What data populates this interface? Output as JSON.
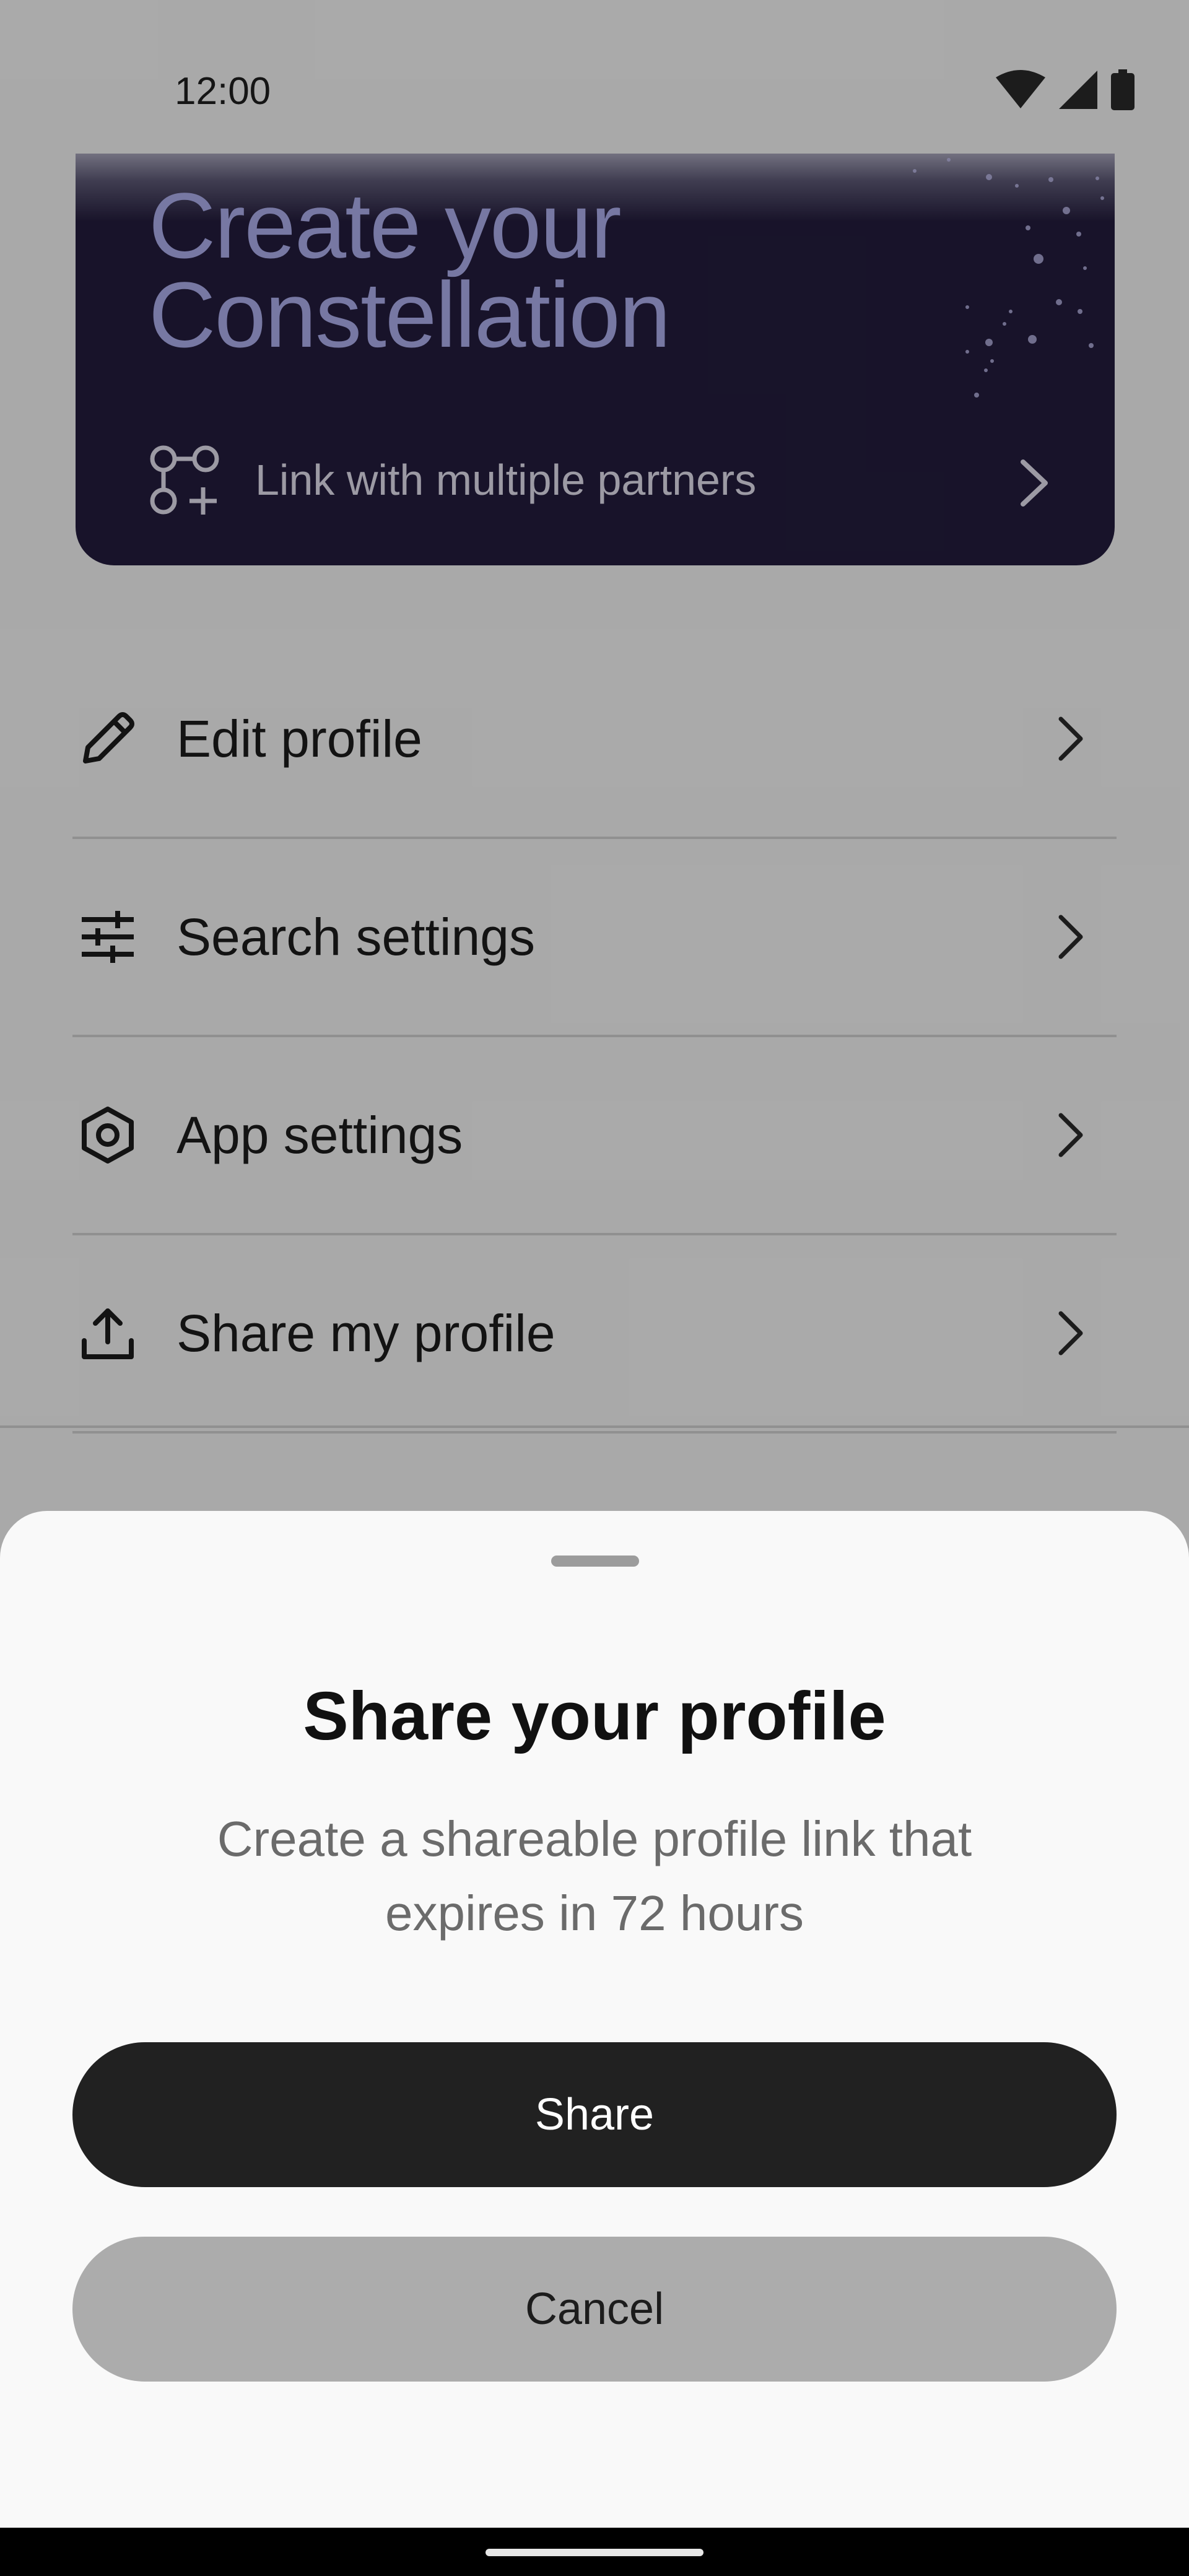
{
  "status_bar": {
    "time": "12:00",
    "icons": [
      "wifi-icon",
      "cell-signal-icon",
      "battery-icon"
    ]
  },
  "promo": {
    "title": "Create your Constellation",
    "link_label": "Link with multiple partners",
    "icon": "link-partners-icon"
  },
  "menu": {
    "items": [
      {
        "label": "Edit profile",
        "icon": "pencil-icon"
      },
      {
        "label": "Search settings",
        "icon": "sliders-icon"
      },
      {
        "label": "App settings",
        "icon": "hexagon-settings-icon"
      },
      {
        "label": "Share my profile",
        "icon": "upload-icon"
      }
    ]
  },
  "sheet": {
    "title": "Share your profile",
    "description": "Create a shareable profile link that expires in 72 hours",
    "share_label": "Share",
    "cancel_label": "Cancel"
  },
  "colors": {
    "promo_background": "#241d3e",
    "promo_title": "#b0b2f0",
    "primary_button": "#212121",
    "secondary_button": "#acacac"
  }
}
